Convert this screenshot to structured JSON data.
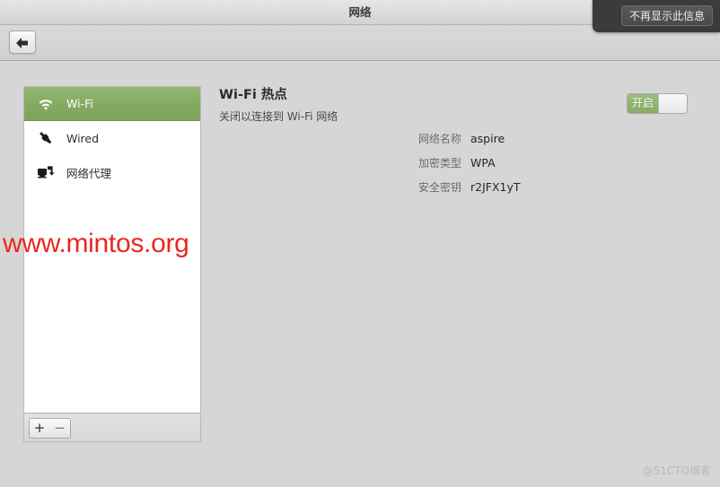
{
  "window": {
    "title": "网络"
  },
  "toolbar": {
    "back_icon": "back-arrow-icon"
  },
  "notification": {
    "dismiss_label": "不再显示此信息"
  },
  "sidebar": {
    "items": [
      {
        "label": "Wi-Fi",
        "icon": "wifi-icon",
        "selected": true
      },
      {
        "label": "Wired",
        "icon": "ethernet-plug-icon",
        "selected": false
      },
      {
        "label": "网络代理",
        "icon": "network-proxy-icon",
        "selected": false
      }
    ],
    "actions": {
      "add_label": "+",
      "remove_label": "−"
    }
  },
  "main": {
    "title": "Wi-Fi 热点",
    "subtitle": "关闭以连接到 Wi-Fi 网络",
    "toggle": {
      "state_label": "开启",
      "on": true
    },
    "details": [
      {
        "label": "网络名称",
        "value": "aspire"
      },
      {
        "label": "加密类型",
        "value": "WPA"
      },
      {
        "label": "安全密钥",
        "value": "r2JFX1yT"
      }
    ]
  },
  "watermarks": {
    "main": "www.mintos.org",
    "corner": "@51CTO博客"
  },
  "colors": {
    "accent_green": "#85ab63",
    "watermark_red": "#e8271f",
    "overlay_dark": "#3b3b3b"
  }
}
